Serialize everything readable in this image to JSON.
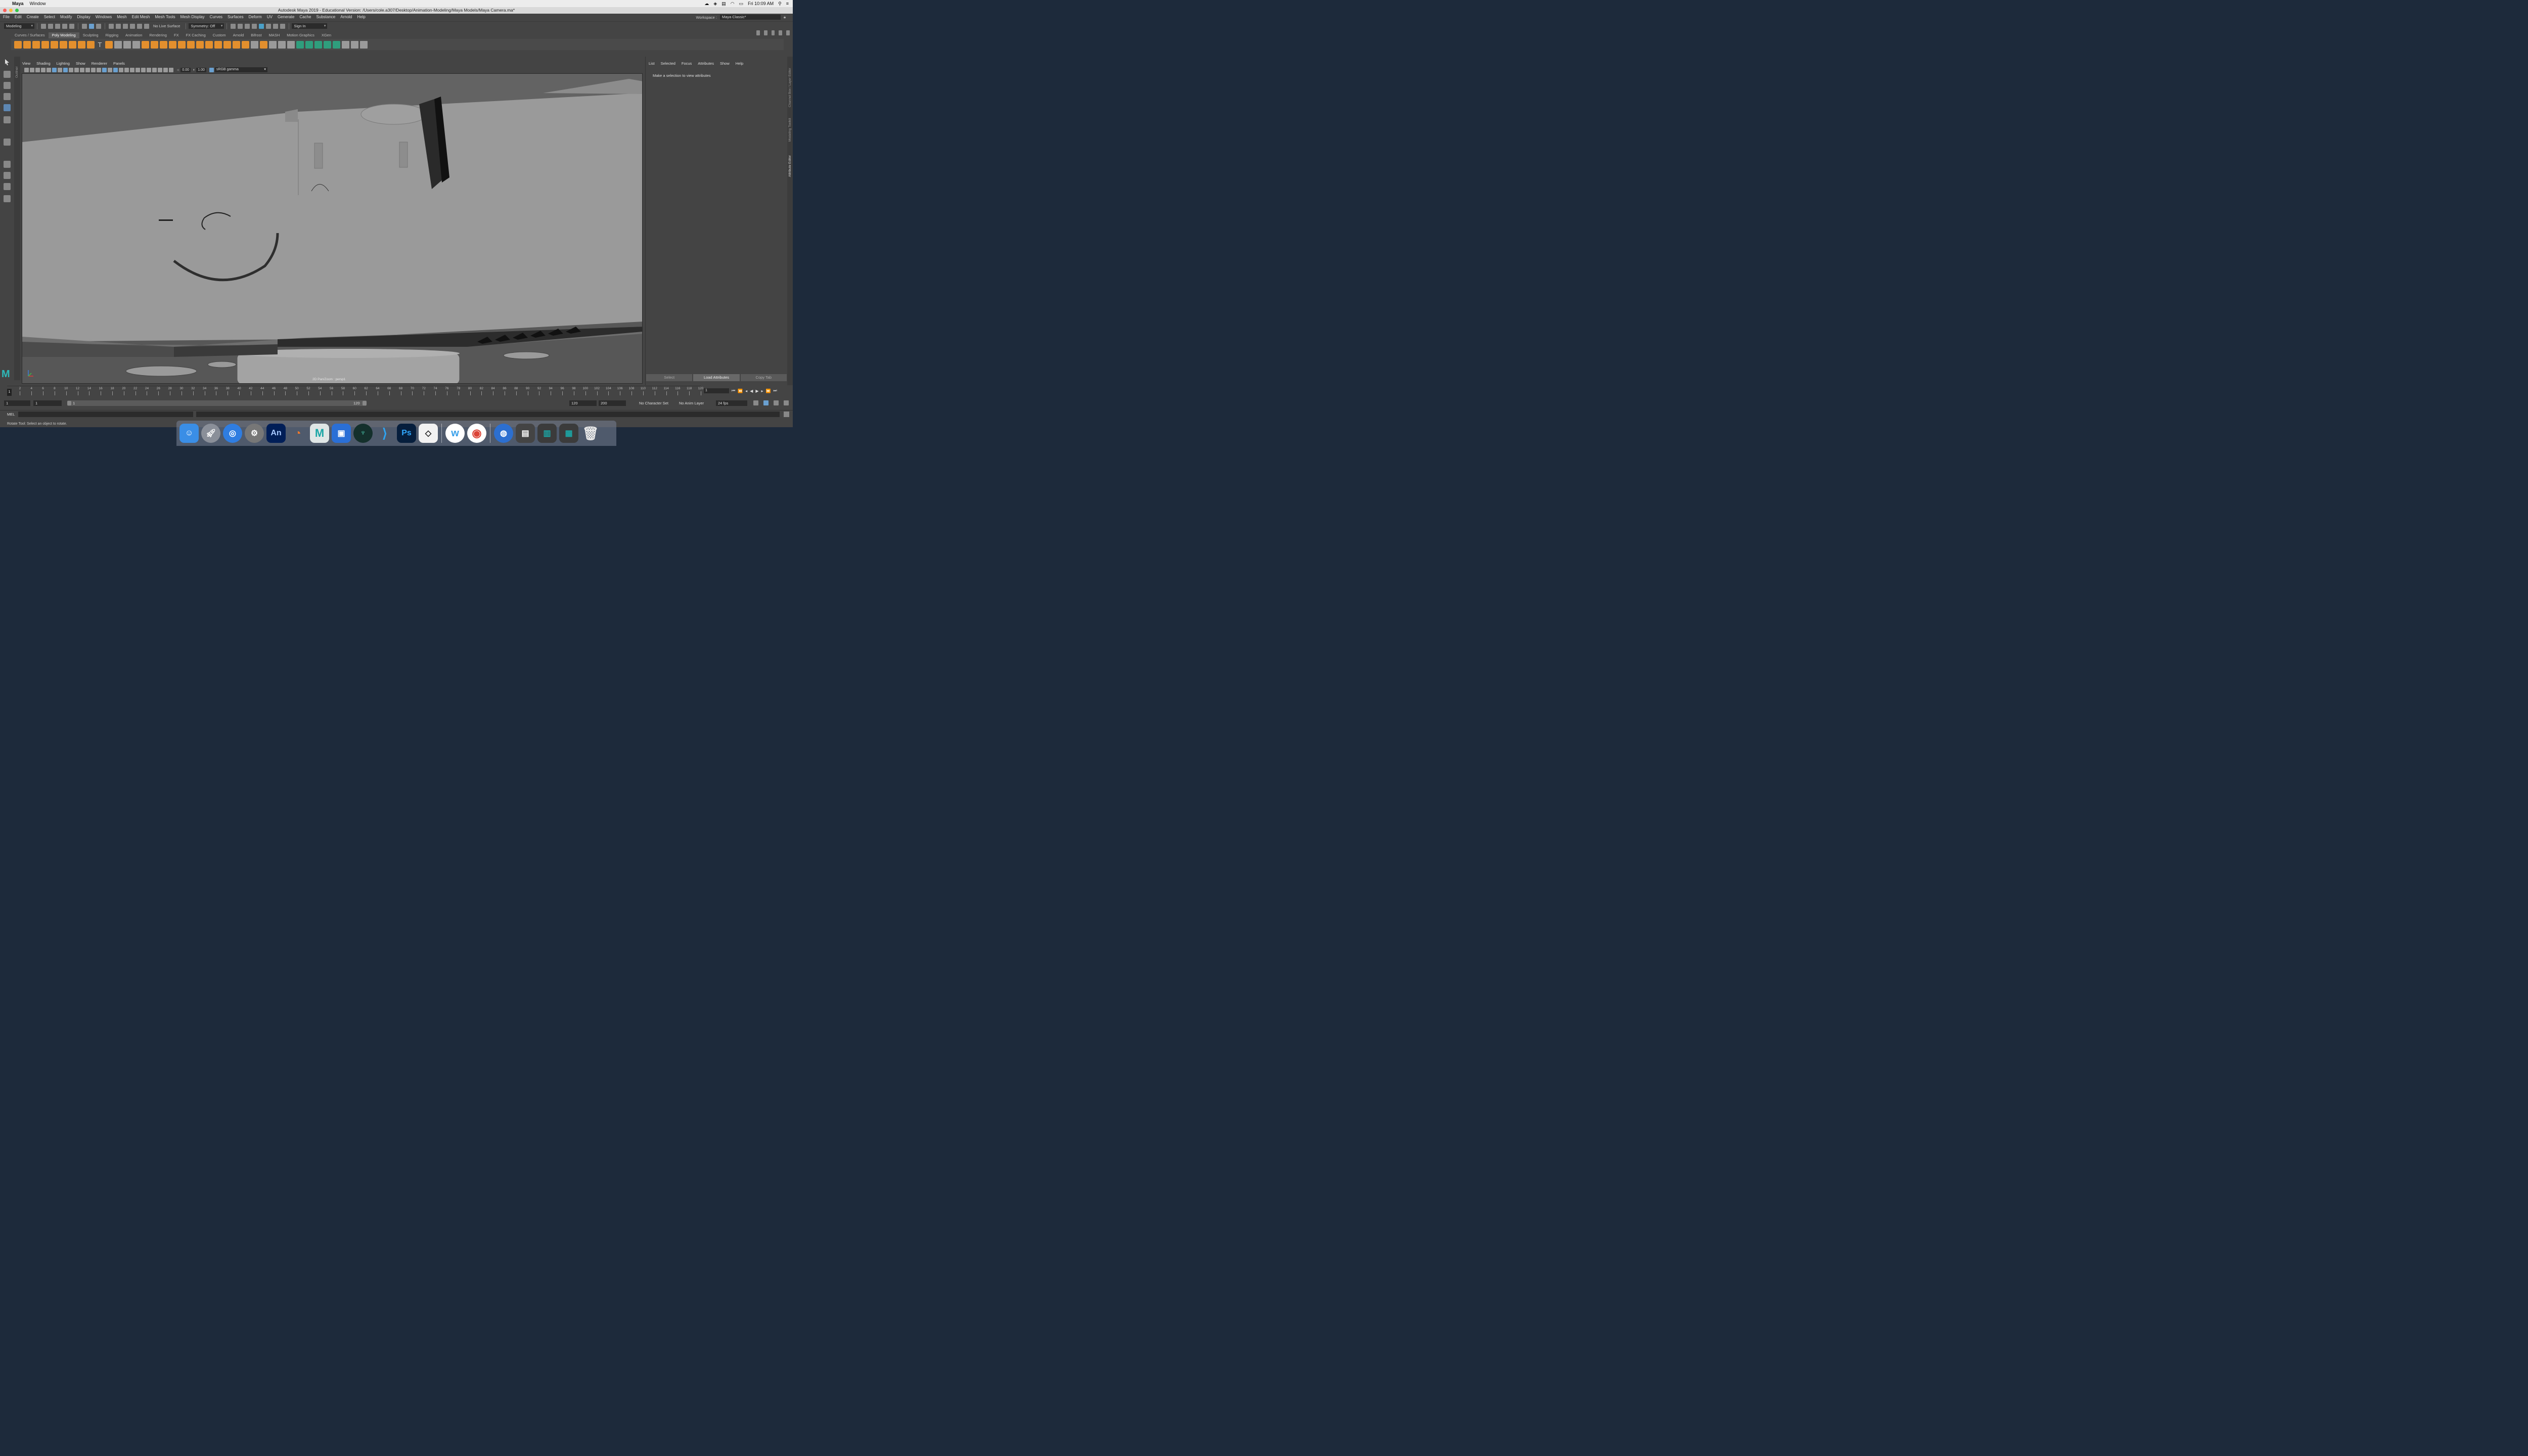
{
  "mac_menu": {
    "app": "Maya",
    "items": [
      "Window"
    ],
    "clock": "Fri 10:09 AM"
  },
  "window": {
    "title": "Autodesk Maya 2019 - Educational Version: /Users/cole.a307/Desktop/Animation-Modeling/Maya Models/Maya Camera.ma*"
  },
  "menus": [
    "File",
    "Edit",
    "Create",
    "Select",
    "Modify",
    "Display",
    "Windows",
    "Mesh",
    "Edit Mesh",
    "Mesh Tools",
    "Mesh Display",
    "Curves",
    "Surfaces",
    "Deform",
    "UV",
    "Generate",
    "Cache",
    "Substance",
    "Arnold",
    "Help"
  ],
  "workspace": {
    "label": "Workspace :",
    "value": "Maya Classic*"
  },
  "statusline": {
    "mode": "Modeling",
    "live_surface": "No Live Surface",
    "symmetry": "Symmetry: Off",
    "sign_in": "Sign In"
  },
  "shelf_tabs": [
    "Curves / Surfaces",
    "Poly Modeling",
    "Sculpting",
    "Rigging",
    "Animation",
    "Rendering",
    "FX",
    "FX Caching",
    "Custom",
    "Arnold",
    "Bifrost",
    "MASH",
    "Motion Graphics",
    "XGen"
  ],
  "shelf_active": "Poly Modeling",
  "panel_menu": [
    "View",
    "Shading",
    "Lighting",
    "Show",
    "Renderer",
    "Panels"
  ],
  "panel_tools": {
    "exposure": "0.00",
    "gamma_value": "1.00",
    "colorspace": "sRGB gamma"
  },
  "viewport": {
    "camera_label": "2D Pan/Zoom : persp1"
  },
  "side_labels": {
    "outliner": "Outliner",
    "channel_box": "Channel Box / Layer Editor",
    "modeling_toolkit": "Modeling Toolkit",
    "attribute_editor": "Attribute Editor"
  },
  "attribute_editor": {
    "menu": [
      "List",
      "Selected",
      "Focus",
      "Attributes",
      "Show",
      "Help"
    ],
    "message": "Make a selection to view attributes",
    "buttons": [
      "Select",
      "Load Attributes",
      "Copy Tab"
    ]
  },
  "timeline": {
    "ticks": [
      "2",
      "4",
      "6",
      "8",
      "10",
      "12",
      "14",
      "16",
      "18",
      "20",
      "22",
      "24",
      "26",
      "28",
      "30",
      "32",
      "34",
      "36",
      "38",
      "40",
      "42",
      "44",
      "46",
      "48",
      "50",
      "52",
      "54",
      "56",
      "58",
      "60",
      "62",
      "64",
      "66",
      "68",
      "70",
      "72",
      "74",
      "76",
      "78",
      "80",
      "82",
      "84",
      "86",
      "88",
      "90",
      "92",
      "94",
      "96",
      "98",
      "100",
      "102",
      "104",
      "106",
      "108",
      "110",
      "112",
      "114",
      "116",
      "118",
      "120"
    ],
    "current": "1",
    "current_frame_field": "1"
  },
  "range": {
    "start": "1",
    "playback_start": "1",
    "slider_start": "1",
    "slider_end": "120",
    "playback_end": "120",
    "end": "200",
    "character_set": "No Character Set",
    "anim_layer": "No Anim Layer",
    "fps": "24 fps"
  },
  "command_line": {
    "label": "MEL"
  },
  "help_line": "Rotate Tool: Select an object to rotate.",
  "dock_apps": [
    "finder-icon",
    "launchpad-icon",
    "safari-icon",
    "system-preferences-icon",
    "animate-icon",
    "blender-icon",
    "maya-icon",
    "screenium-icon",
    "gitkraken-icon",
    "vscode-icon",
    "photoshop-icon",
    "unity-icon",
    "wunderlist-icon",
    "chrome-icon",
    "downloads-icon",
    "scanner-icon",
    "maya-file-icon",
    "maya-file2-icon",
    "trash-icon"
  ],
  "dock_text": {
    "animate": "An",
    "maya": "M",
    "photoshop": "Ps",
    "wunderlist": "w"
  }
}
